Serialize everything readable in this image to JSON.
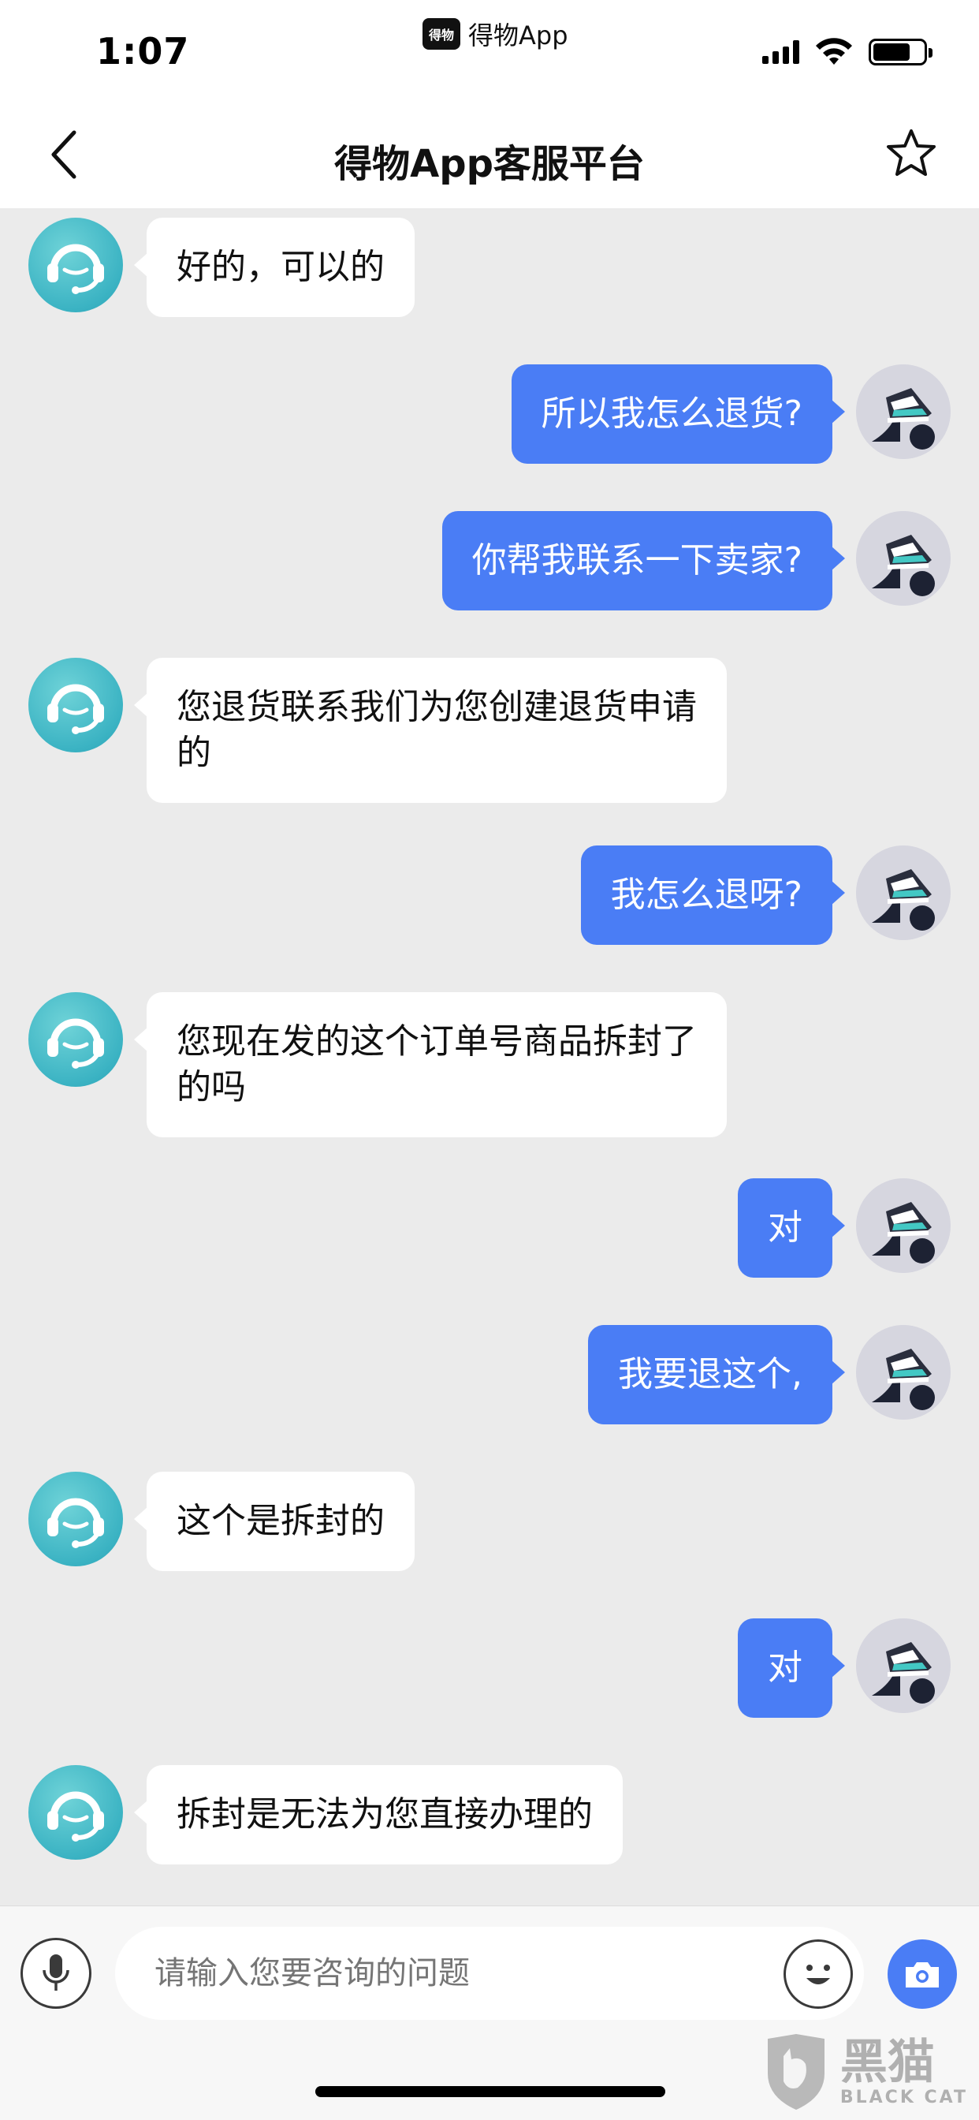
{
  "status_bar": {
    "time": "1:07",
    "app_logo": "得物",
    "app_name": "得物App",
    "battery_level": 0.74
  },
  "nav": {
    "title": "得物App客服平台",
    "back_icon": "chevron-left-icon",
    "favorite_icon": "star-outline-icon"
  },
  "messages": [
    {
      "from": "agent",
      "lines": [
        "好的，可以的"
      ]
    },
    {
      "from": "user",
      "lines": [
        "所以我怎么退货?"
      ]
    },
    {
      "from": "user",
      "lines": [
        "你帮我联系一下卖家?"
      ]
    },
    {
      "from": "agent",
      "lines": [
        "您退货联系我们为您创建退货申请",
        "的"
      ]
    },
    {
      "from": "user",
      "lines": [
        "我怎么退呀?"
      ]
    },
    {
      "from": "agent",
      "lines": [
        "您现在发的这个订单号商品拆封了",
        "的吗"
      ]
    },
    {
      "from": "user",
      "lines": [
        "对"
      ]
    },
    {
      "from": "user",
      "lines": [
        "我要退这个,"
      ]
    },
    {
      "from": "agent",
      "lines": [
        "这个是拆封的"
      ]
    },
    {
      "from": "user",
      "lines": [
        "对"
      ]
    },
    {
      "from": "agent",
      "lines": [
        "拆封是无法为您直接办理的"
      ]
    }
  ],
  "input": {
    "placeholder": "请输入您要咨询的问题"
  },
  "watermark": {
    "cn": "黑猫",
    "en": "BLACK CAT"
  },
  "colors": {
    "user_bubble": "#4a7df5",
    "agent_bubble": "#ffffff",
    "background": "#ebebeb",
    "agent_avatar": "#3bb3c3"
  }
}
